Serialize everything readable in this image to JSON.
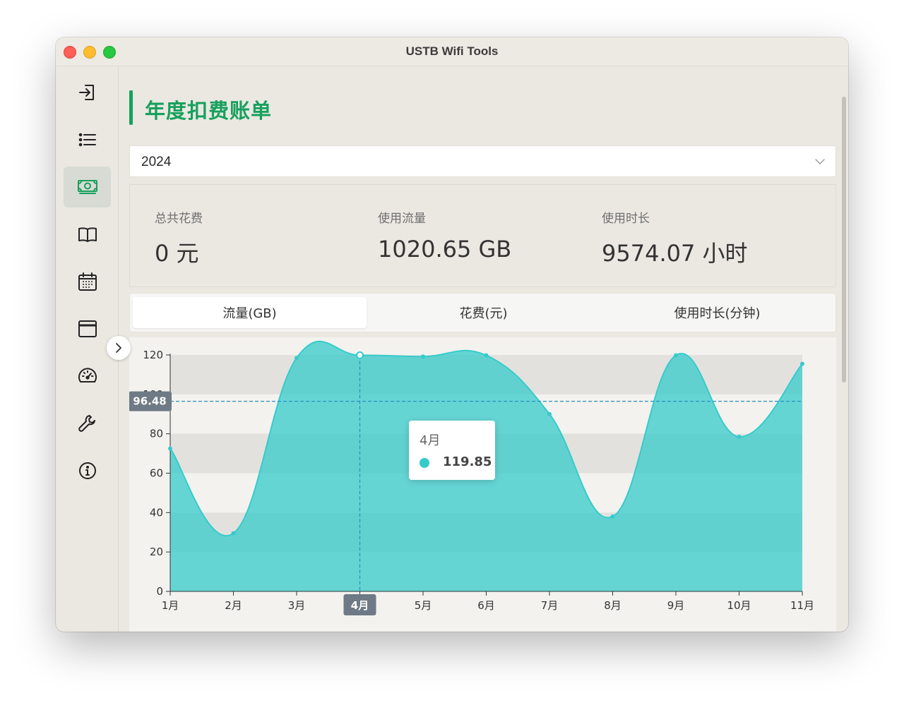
{
  "window": {
    "title": "USTB Wifi Tools"
  },
  "sidebar": {
    "items": [
      {
        "icon": "login-icon",
        "active": false
      },
      {
        "icon": "list-icon",
        "active": false
      },
      {
        "icon": "money-icon",
        "active": true
      },
      {
        "icon": "book-icon",
        "active": false
      },
      {
        "icon": "calendar-icon",
        "active": false
      },
      {
        "icon": "window-icon",
        "active": false
      },
      {
        "icon": "speedometer-icon",
        "active": false
      },
      {
        "icon": "wrench-icon",
        "active": false
      },
      {
        "icon": "info-icon",
        "active": false
      }
    ],
    "accent_color": "#17a05d"
  },
  "page": {
    "title": "年度扣费账单"
  },
  "year_select": {
    "value": "2024"
  },
  "stats": [
    {
      "label": "总共花费",
      "value": "0 元"
    },
    {
      "label": "使用流量",
      "value": "1020.65 GB"
    },
    {
      "label": "使用时长",
      "value": "9574.07 小时"
    }
  ],
  "tabs": [
    {
      "label": "流量(GB)",
      "active": true
    },
    {
      "label": "花费(元)",
      "active": false
    },
    {
      "label": "使用时长(分钟)",
      "active": false
    }
  ],
  "tooltip": {
    "title": "4月",
    "value": "119.85"
  },
  "chart_data": {
    "type": "area",
    "categories": [
      "1月",
      "2月",
      "3月",
      "4月",
      "5月",
      "6月",
      "7月",
      "8月",
      "9月",
      "10月",
      "11月"
    ],
    "values": [
      72.5,
      29.5,
      118.5,
      119.85,
      119.2,
      119.8,
      90,
      38,
      119.8,
      78.5,
      115.5
    ],
    "ylim": [
      0,
      120
    ],
    "yticks": [
      0,
      20,
      40,
      60,
      80,
      100,
      120
    ],
    "crosshair_y_label": "96.48",
    "crosshair_y_value": 96.48,
    "crosshair_x_label": "4月",
    "color": "#36cbcb",
    "grid": "banded"
  }
}
